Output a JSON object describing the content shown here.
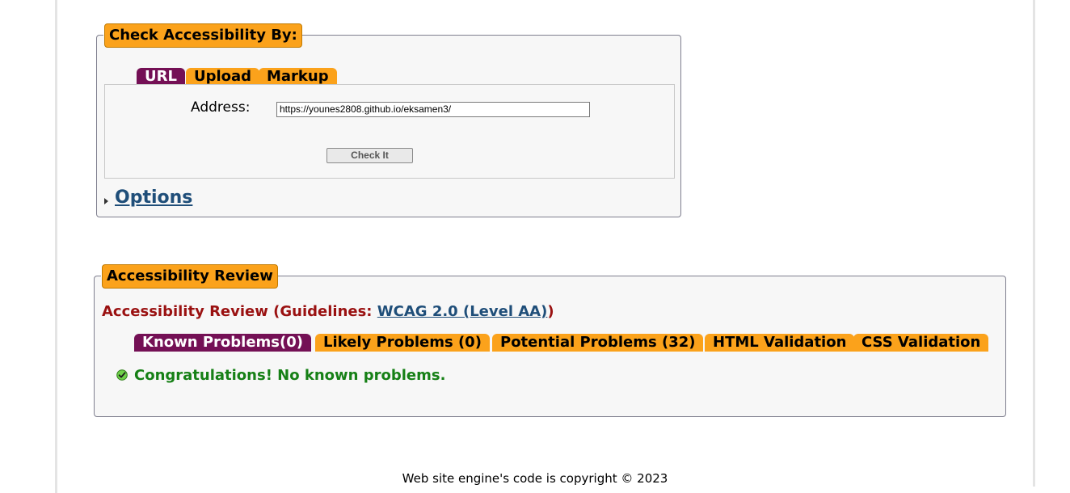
{
  "check_box": {
    "legend": "Check Accessibility By:",
    "tabs": [
      {
        "label": "URL",
        "active": true
      },
      {
        "label": "Upload",
        "active": false
      },
      {
        "label": "Markup",
        "active": false
      }
    ],
    "address_label": "Address:",
    "address_value": "https://younes2808.github.io/eksamen3/",
    "check_button": "Check It",
    "options_link": "Options"
  },
  "review_box": {
    "legend": "Accessibility Review",
    "heading_prefix": "Accessibility Review (Guidelines: ",
    "guideline_link": "WCAG 2.0 (Level AA)",
    "heading_suffix": ")",
    "tabs": [
      {
        "label": "Known Problems(0)",
        "active": true
      },
      {
        "label": "Likely Problems (0)",
        "active": false
      },
      {
        "label": "Potential Problems (32)",
        "active": false
      },
      {
        "label": "HTML Validation",
        "active": false
      },
      {
        "label": "CSS Validation",
        "active": false
      }
    ],
    "result_icon": "green-check-icon",
    "result_message": "Congratulations! No known problems."
  },
  "footer": {
    "copyright": "Web site engine's code is copyright © 2023"
  },
  "colors": {
    "tab_orange": "#fba21b",
    "tab_active": "#741055",
    "heading_red": "#9a1111",
    "link_blue": "#1f4e79",
    "success_green": "#168016"
  }
}
